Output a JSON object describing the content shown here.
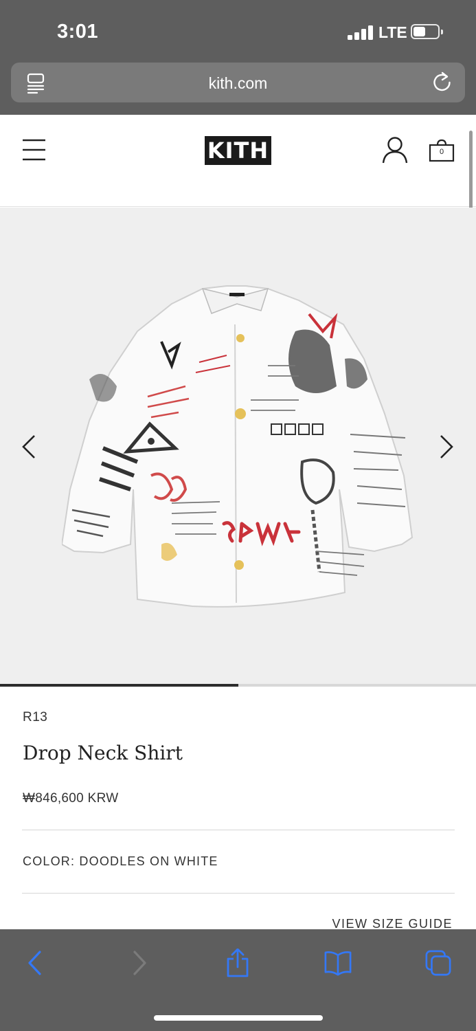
{
  "status_bar": {
    "time": "3:01",
    "network": "LTE",
    "battery_level": 0.5
  },
  "browser": {
    "url": "kith.com"
  },
  "header": {
    "logo_text": "KITH",
    "cart_count": "0"
  },
  "gallery": {
    "image_icon": "patterned-shirt",
    "progress": 0.5
  },
  "product": {
    "brand": "R13",
    "title": "Drop Neck Shirt",
    "price": "₩846,600 KRW",
    "color_label": "COLOR: DOODLES ON WHITE",
    "size_guide": "VIEW SIZE GUIDE"
  },
  "colors": {
    "browser_chrome": "#5e5e5e",
    "accent_blue": "#3478f6",
    "gallery_bg": "#efefef",
    "logo_bg": "#1b1b1b"
  }
}
